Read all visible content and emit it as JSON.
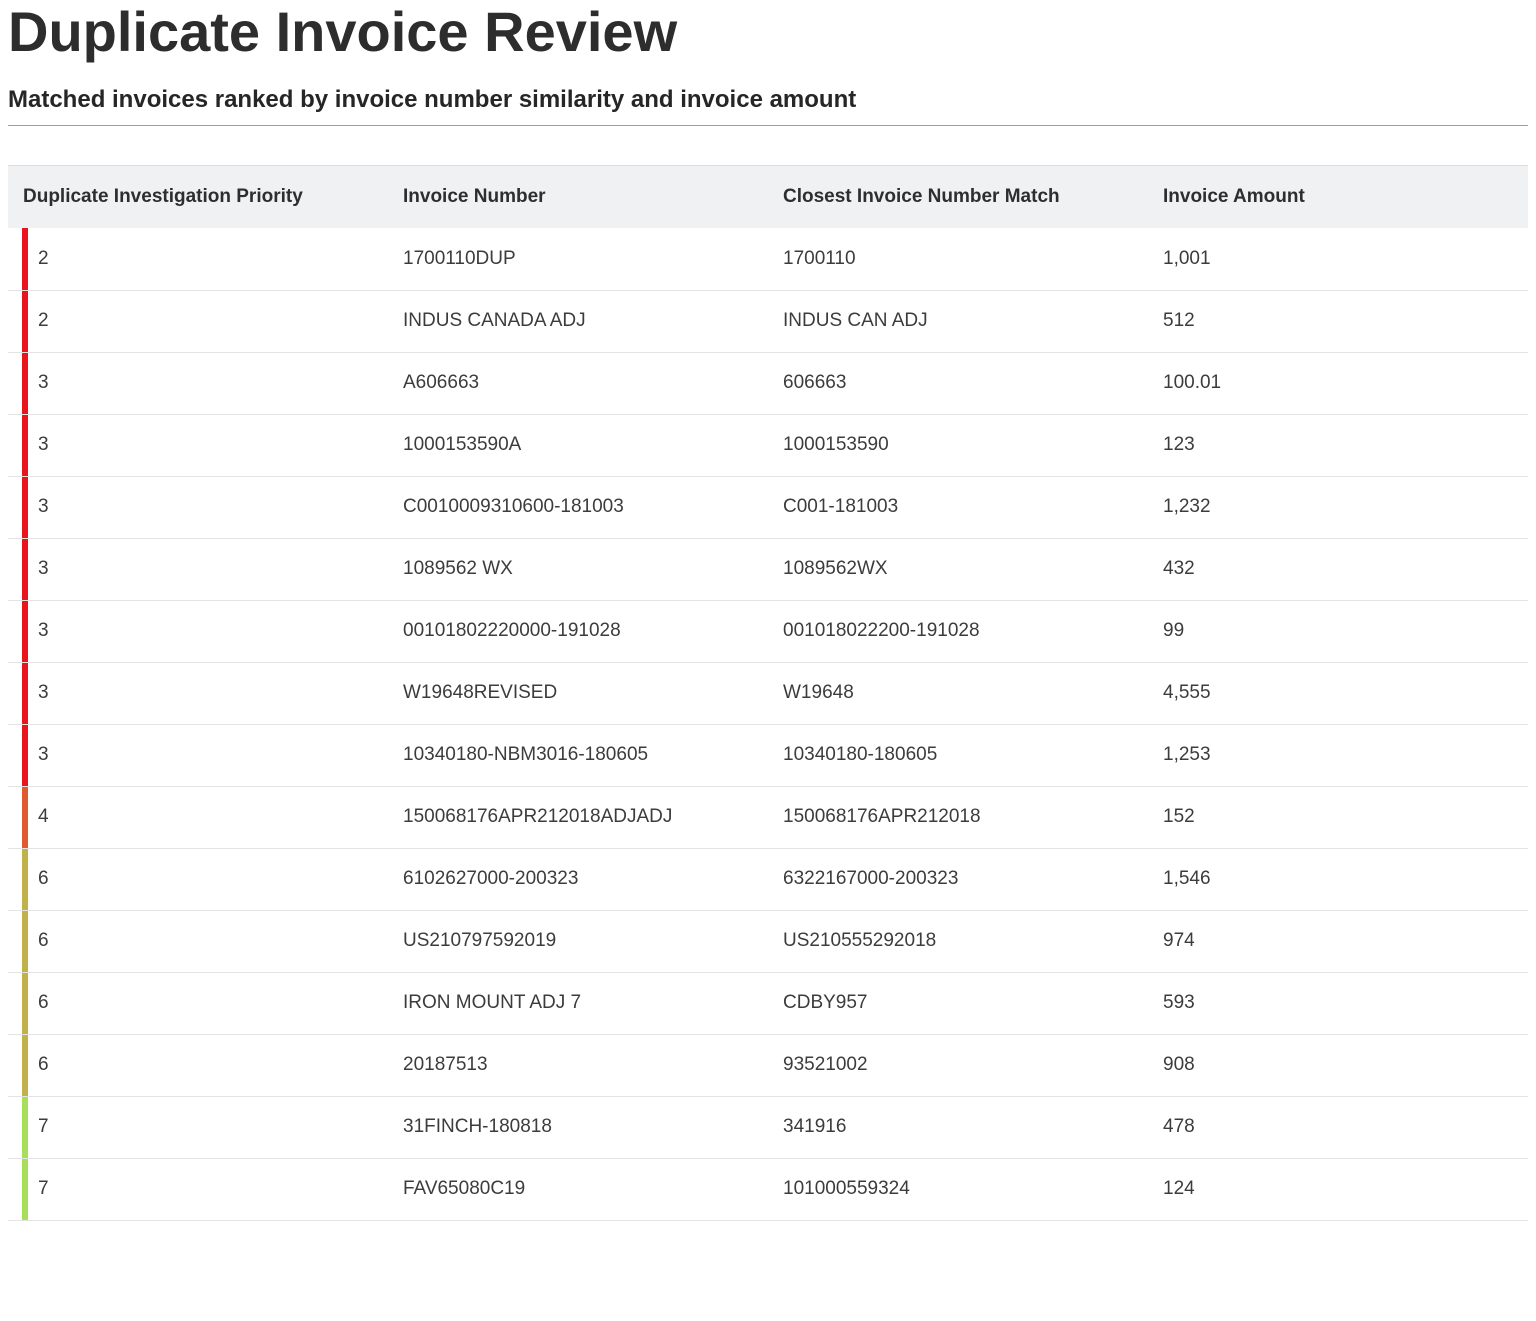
{
  "page": {
    "title": "Duplicate Invoice Review",
    "subtitle": "Matched invoices ranked by invoice number similarity and invoice amount"
  },
  "table": {
    "columns": [
      "Duplicate Investigation Priority",
      "Invoice Number",
      "Closest Invoice Number Match",
      "Invoice Amount"
    ],
    "priority_colors": {
      "2": "#e8141e",
      "3": "#e8141e",
      "4": "#e05a30",
      "6": "#c2b04a",
      "7": "#a8df5a"
    },
    "rows": [
      {
        "priority": "2",
        "invoice_number": "1700110DUP",
        "closest_match": "1700110",
        "amount": "1,001"
      },
      {
        "priority": "2",
        "invoice_number": "INDUS CANADA ADJ",
        "closest_match": "INDUS CAN ADJ",
        "amount": "512"
      },
      {
        "priority": "3",
        "invoice_number": "A606663",
        "closest_match": "606663",
        "amount": "100.01"
      },
      {
        "priority": "3",
        "invoice_number": "1000153590A",
        "closest_match": "1000153590",
        "amount": "123"
      },
      {
        "priority": "3",
        "invoice_number": "C0010009310600-181003",
        "closest_match": "C001-181003",
        "amount": "1,232"
      },
      {
        "priority": "3",
        "invoice_number": "1089562 WX",
        "closest_match": "1089562WX",
        "amount": "432"
      },
      {
        "priority": "3",
        "invoice_number": "00101802220000-191028",
        "closest_match": "001018022200-191028",
        "amount": "99"
      },
      {
        "priority": "3",
        "invoice_number": "W19648REVISED",
        "closest_match": "W19648",
        "amount": "4,555"
      },
      {
        "priority": "3",
        "invoice_number": "10340180-NBM3016-180605",
        "closest_match": "10340180-180605",
        "amount": "1,253"
      },
      {
        "priority": "4",
        "invoice_number": "150068176APR212018ADJADJ",
        "closest_match": "150068176APR212018",
        "amount": "152"
      },
      {
        "priority": "6",
        "invoice_number": "6102627000-200323",
        "closest_match": "6322167000-200323",
        "amount": "1,546"
      },
      {
        "priority": "6",
        "invoice_number": "US210797592019",
        "closest_match": "US210555292018",
        "amount": "974"
      },
      {
        "priority": "6",
        "invoice_number": "IRON MOUNT ADJ 7",
        "closest_match": "CDBY957",
        "amount": "593"
      },
      {
        "priority": "6",
        "invoice_number": "20187513",
        "closest_match": "93521002",
        "amount": "908"
      },
      {
        "priority": "7",
        "invoice_number": "31FINCH-180818",
        "closest_match": "341916",
        "amount": "478"
      },
      {
        "priority": "7",
        "invoice_number": "FAV65080C19",
        "closest_match": "101000559324",
        "amount": "124"
      }
    ]
  }
}
